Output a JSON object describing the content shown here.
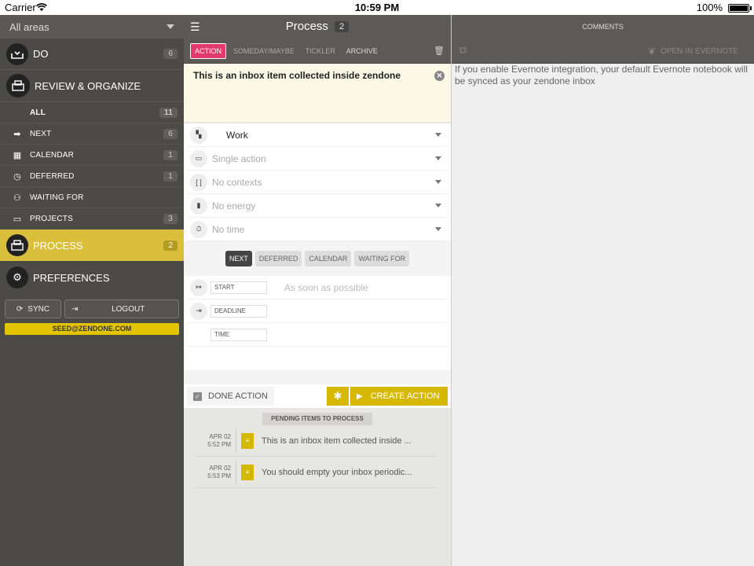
{
  "status_bar": {
    "carrier": "Carrier",
    "wifi_icon": "wifi-icon",
    "time": "10:59 PM",
    "battery": "100%"
  },
  "sidebar": {
    "area_selector": "All areas",
    "do": {
      "label": "DO",
      "count": "6"
    },
    "review": {
      "label": "REVIEW & ORGANIZE"
    },
    "sub_items": [
      {
        "label": "ALL",
        "count": "11",
        "icon": ""
      },
      {
        "label": "NEXT",
        "count": "6",
        "icon": "next-icon"
      },
      {
        "label": "CALENDAR",
        "count": "1",
        "icon": "calendar-icon"
      },
      {
        "label": "DEFERRED",
        "count": "1",
        "icon": "deferred-icon"
      },
      {
        "label": "WAITING FOR",
        "count": "",
        "icon": "waiting-icon"
      },
      {
        "label": "PROJECTS",
        "count": "3",
        "icon": "projects-icon"
      }
    ],
    "process": {
      "label": "PROCESS",
      "count": "2"
    },
    "preferences": {
      "label": "PREFERENCES"
    },
    "sync_label": "SYNC",
    "logout_label": "LOGOUT",
    "email": "SEED@ZENDONE.COM"
  },
  "process_panel": {
    "title": "Process",
    "count": "2",
    "tabs": [
      "ACTION",
      "SOMEDAY/MAYBE",
      "TICKLER",
      "ARCHIVE"
    ],
    "active_tab": "ACTION",
    "item_text": "This is an inbox item collected inside zendone",
    "fields": {
      "area": "Work",
      "type": "Single action",
      "contexts": "No contexts",
      "energy": "No energy",
      "time": "No time"
    },
    "segments": [
      "NEXT",
      "DEFERRED",
      "CALENDAR",
      "WAITING FOR"
    ],
    "active_segment": "NEXT",
    "start_label": "START",
    "start_value": "As soon as possible",
    "deadline_label": "DEADLINE",
    "time_label": "TIME",
    "done_label": "DONE ACTION",
    "create_label": "CREATE ACTION",
    "pending_header": "PENDING ITEMS TO PROCESS",
    "pending": [
      {
        "date": "APR 02",
        "time": "5:52 PM",
        "text": "This is an inbox item collected inside ..."
      },
      {
        "date": "APR 02",
        "time": "5:53 PM",
        "text": "You should empty your inbox periodic..."
      }
    ]
  },
  "comments_panel": {
    "header": "COMMENTS",
    "evernote_label": "OPEN IN EVERNOTE",
    "message": "If you enable Evernote integration, your default Evernote notebook will be synced as your zendone inbox"
  },
  "colors": {
    "accent_process": "#d9bf3b",
    "active_tab": "#e23a6b",
    "button_yellow": "#d7b800",
    "sidebar_bg": "#4b4a47"
  }
}
